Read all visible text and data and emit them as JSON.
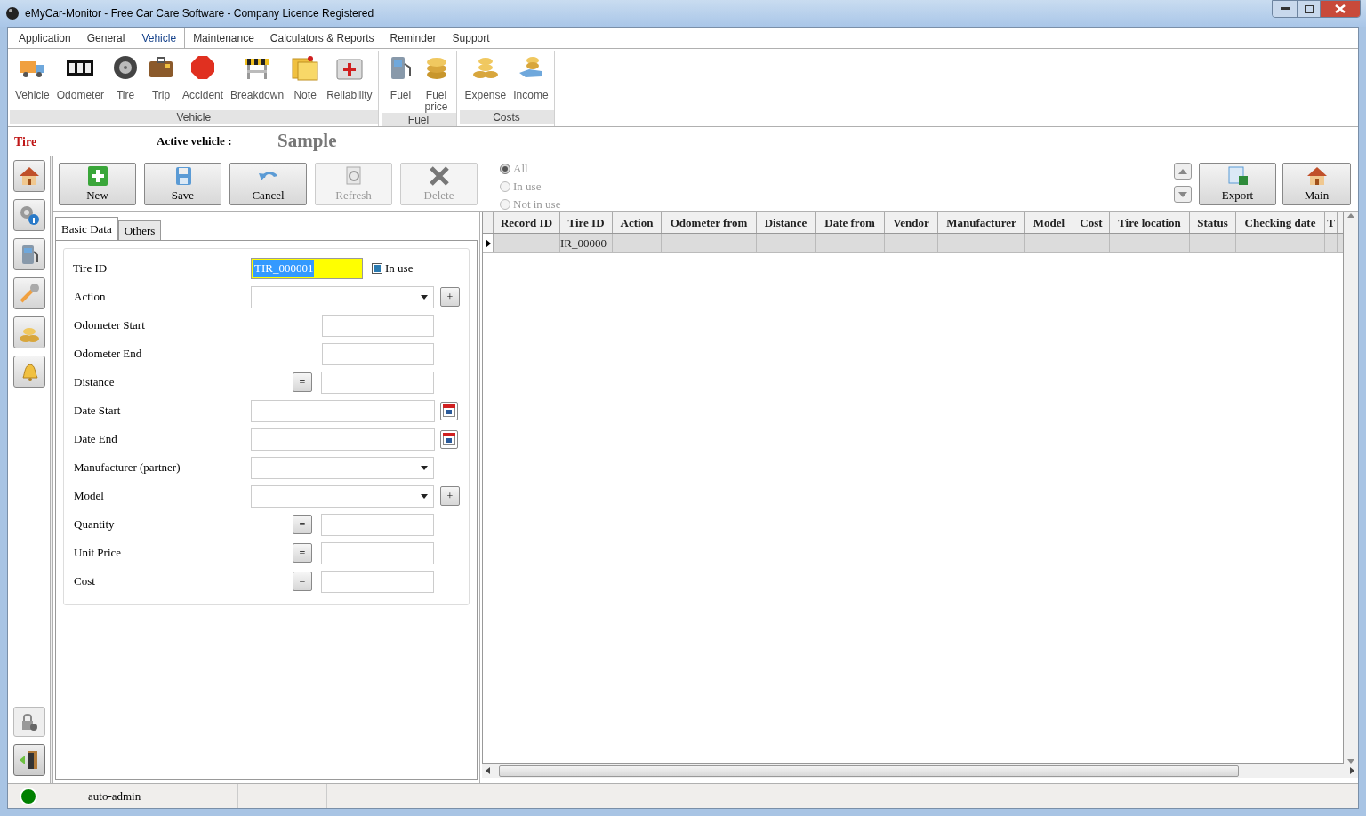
{
  "window": {
    "title": "eMyCar-Monitor - Free Car Care Software - Company Licence Registered"
  },
  "menu": [
    {
      "label": "Application",
      "selected": false
    },
    {
      "label": "General",
      "selected": false
    },
    {
      "label": "Vehicle",
      "selected": true
    },
    {
      "label": "Maintenance",
      "selected": false
    },
    {
      "label": "Calculators & Reports",
      "selected": false
    },
    {
      "label": "Reminder",
      "selected": false
    },
    {
      "label": "Support",
      "selected": false
    }
  ],
  "ribbon": [
    {
      "label": "Vehicle",
      "items": [
        "Vehicle",
        "Odometer",
        "Tire",
        "Trip",
        "Accident",
        "Breakdown",
        "Note",
        "Reliability"
      ]
    },
    {
      "label": "Fuel",
      "items": [
        "Fuel",
        "Fuel price"
      ]
    },
    {
      "label": "Costs",
      "items": [
        "Expense",
        "Income"
      ]
    }
  ],
  "context": {
    "module": "Tire",
    "vehicle_label": "Active vehicle :",
    "vehicle": "Sample"
  },
  "toolbar": [
    {
      "label": "New",
      "disabled": false
    },
    {
      "label": "Save",
      "disabled": false
    },
    {
      "label": "Cancel",
      "disabled": false
    },
    {
      "label": "Refresh",
      "disabled": true
    },
    {
      "label": "Delete",
      "disabled": true
    }
  ],
  "filter": {
    "disabled": true,
    "options": [
      {
        "label": "All",
        "selected": true
      },
      {
        "label": "In use",
        "selected": false
      },
      {
        "label": "Not in use",
        "selected": false
      }
    ]
  },
  "actions": [
    "Export",
    "Main"
  ],
  "form_tabs": [
    {
      "label": "Basic Data",
      "selected": true
    },
    {
      "label": "Others",
      "selected": false
    }
  ],
  "form": {
    "id_label": "Tire ID",
    "id_value": "TIR_000001",
    "in_use_label": "In use",
    "in_use": true,
    "fields": [
      {
        "label": "Action",
        "kind": "combo",
        "add_button": "+"
      },
      {
        "label": "Odometer Start",
        "kind": "number"
      },
      {
        "label": "Odometer End",
        "kind": "number"
      },
      {
        "label": "Distance",
        "kind": "calc",
        "button": "="
      },
      {
        "label": "Date Start",
        "kind": "date"
      },
      {
        "label": "Date End",
        "kind": "date"
      },
      {
        "label": "Manufacturer (partner)",
        "kind": "combo"
      },
      {
        "label": "Model",
        "kind": "combo",
        "add_button": "+"
      },
      {
        "label": "Quantity",
        "kind": "calc",
        "button": "="
      },
      {
        "label": "Unit Price",
        "kind": "calc",
        "button": "="
      },
      {
        "label": "Cost",
        "kind": "calc",
        "button": "="
      }
    ]
  },
  "table": {
    "columns": [
      "Record ID",
      "Tire ID",
      "Action",
      "Odometer from",
      "Distance",
      "Date from",
      "Vendor",
      "Manufacturer",
      "Model",
      "Cost",
      "Tire location",
      "Status",
      "Checking date",
      "T"
    ],
    "rows": [
      {
        "current": true,
        "cells": {
          "1": "IR_00000"
        }
      }
    ]
  },
  "status_bar": {
    "online": true,
    "user": "auto-admin"
  }
}
